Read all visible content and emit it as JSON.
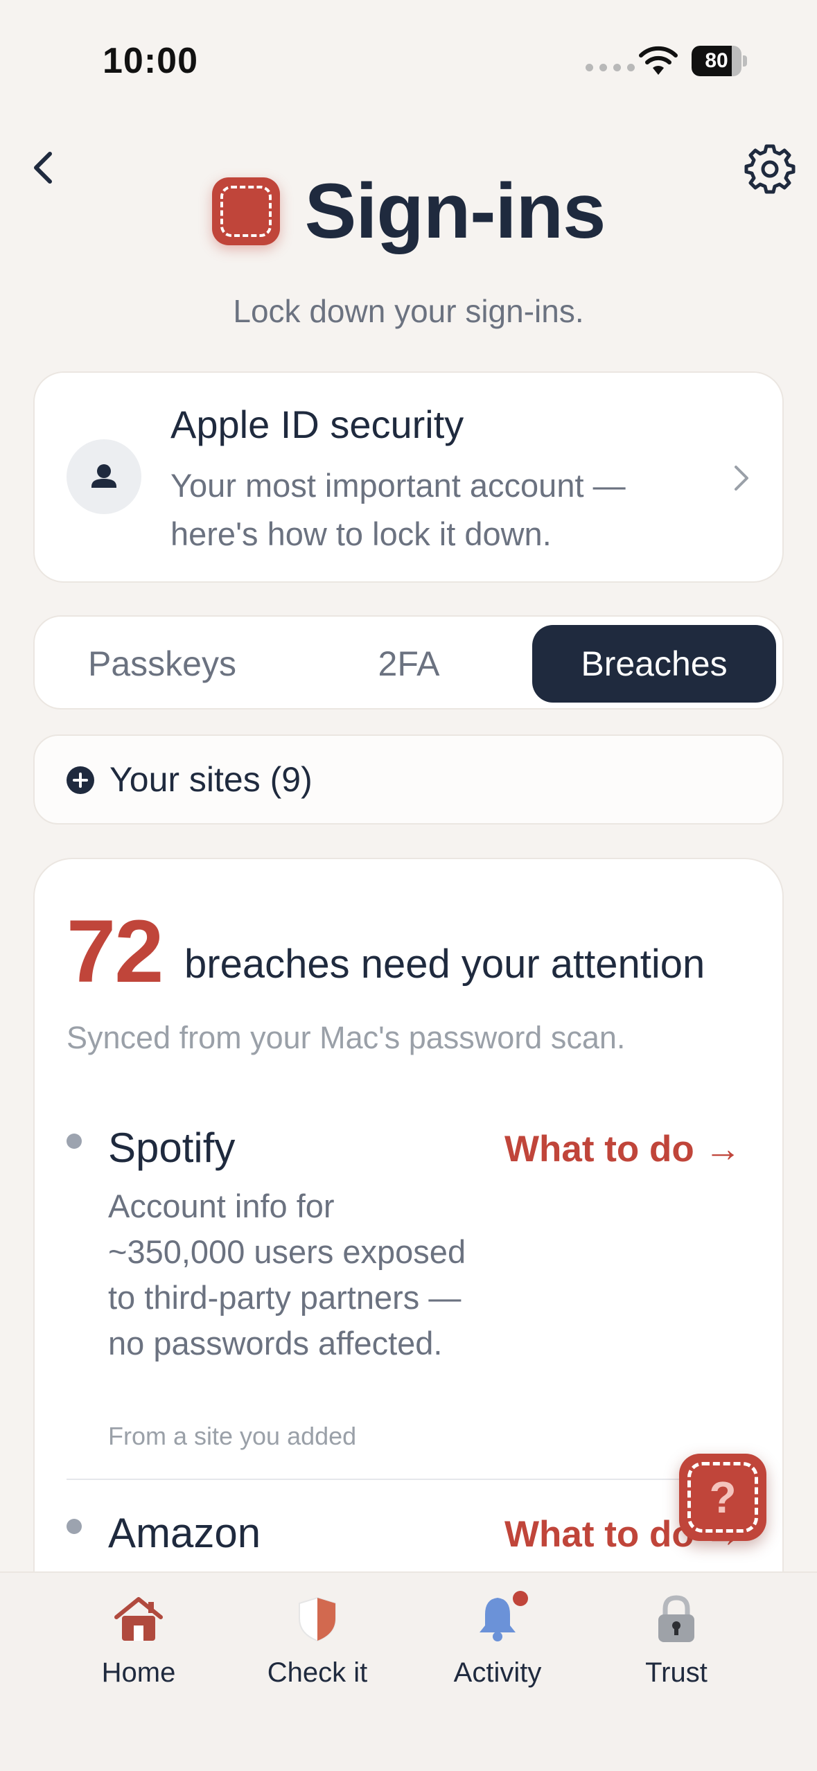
{
  "status_bar": {
    "time": "10:00",
    "battery": "80",
    "battery_level": 0.8
  },
  "header": {
    "title": "Sign-ins",
    "subtitle": "Lock down your sign-ins."
  },
  "apple_id": {
    "title": "Apple ID security",
    "description": "Your most important account — here's how to lock it down."
  },
  "segments": {
    "items": [
      {
        "label": "Passkeys",
        "active": false
      },
      {
        "label": "2FA",
        "active": false
      },
      {
        "label": "Breaches",
        "active": true
      }
    ]
  },
  "sites": {
    "label": "Your sites (9)"
  },
  "breaches": {
    "count": "72",
    "headline": "breaches need your attention",
    "subtitle": "Synced from your Mac's password scan.",
    "items": [
      {
        "name": "Spotify",
        "action": "What to do →",
        "description": "Account info for ~350,000 users exposed to third-party partners — no passwords affected.",
        "source": "From a site you added"
      },
      {
        "name": "Amazon",
        "action": "What to do →"
      }
    ]
  },
  "help": {
    "label": "?"
  },
  "tabbar": {
    "items": [
      {
        "label": "Home",
        "icon": "home-icon"
      },
      {
        "label": "Check it",
        "icon": "shield-icon"
      },
      {
        "label": "Activity",
        "icon": "bell-icon"
      },
      {
        "label": "Trust",
        "icon": "lock-icon"
      }
    ]
  },
  "colors": {
    "accent": "#c0453a",
    "navy": "#1f2a3e",
    "background": "#f6f3f0",
    "activity_blue": "#6b92d8"
  }
}
